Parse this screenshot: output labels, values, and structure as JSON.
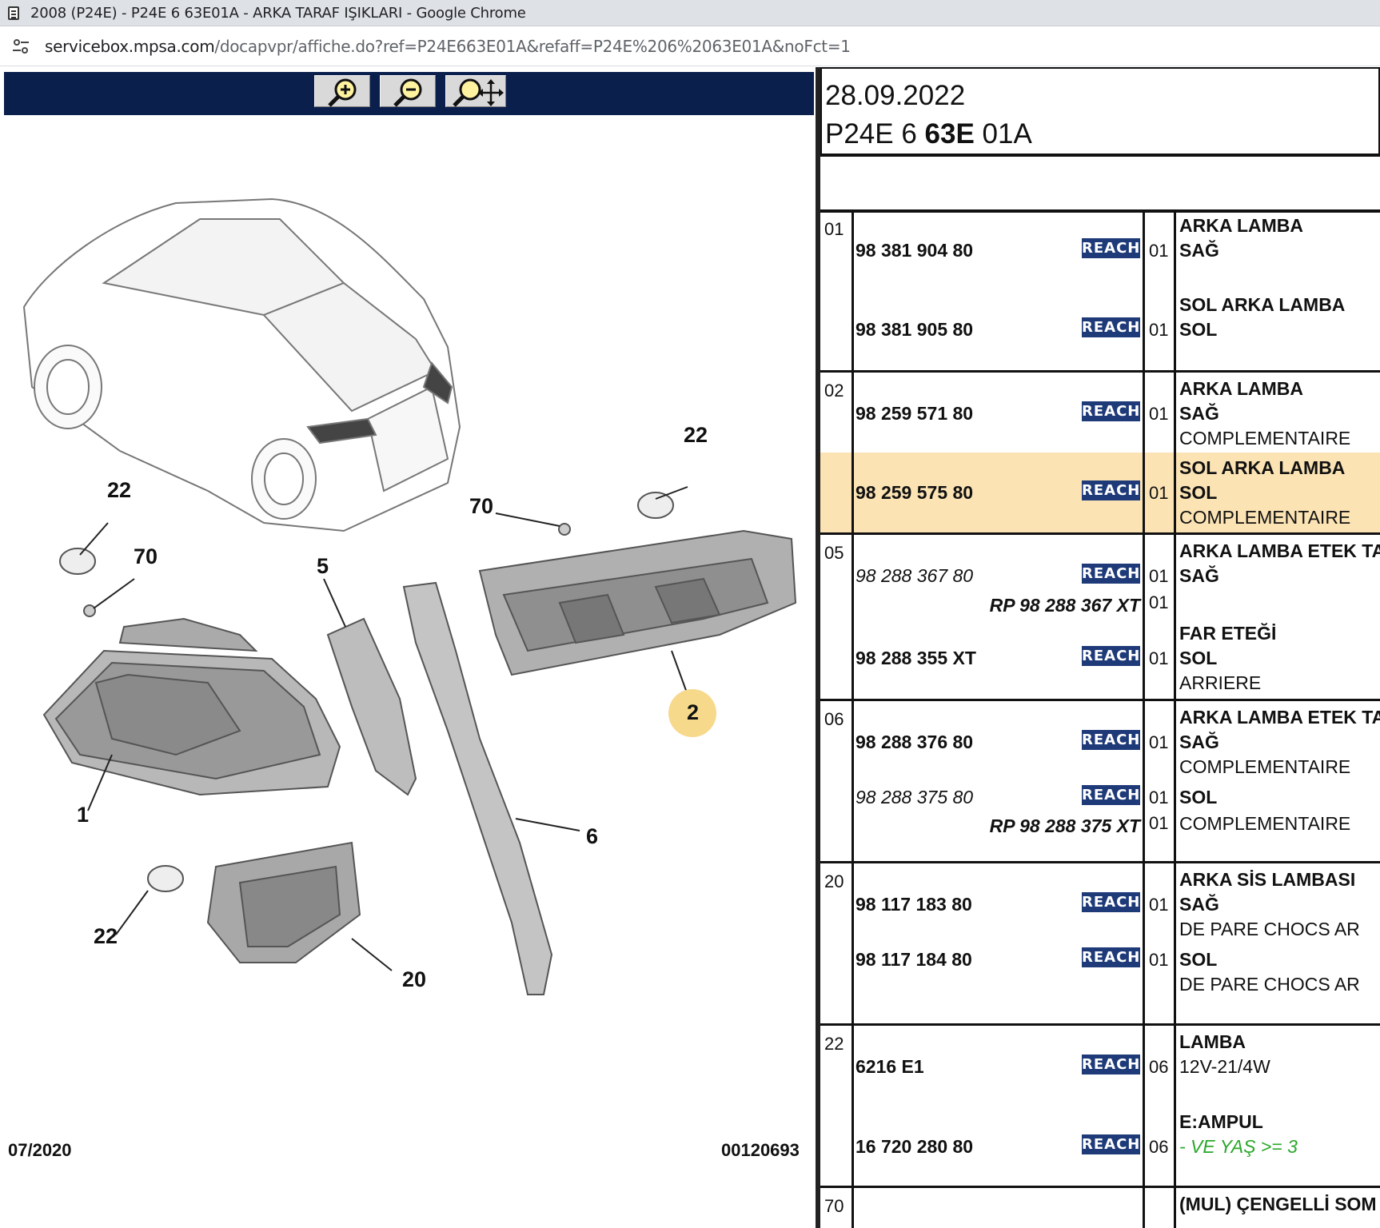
{
  "browser": {
    "title": "2008 (P24E) - P24E 6 63E01A - ARKA TARAF IŞIKLARI - Google Chrome",
    "url_host": "servicebox.mpsa.com",
    "url_path": "/docapvpr/affiche.do?ref=P24E663E01A&refaff=P24E%206%2063E01A&noFct=1"
  },
  "toolbar": {
    "zoom_in": "zoom-in-icon",
    "zoom_out": "zoom-out-icon",
    "pan": "zoom-pan-icon"
  },
  "diagram": {
    "date_code": "07/2020",
    "image_code": "00120693",
    "callouts": [
      "22",
      "22",
      "70",
      "70",
      "5",
      "1",
      "6",
      "2",
      "22",
      "20"
    ],
    "highlight_color": "#f7d98c"
  },
  "header": {
    "date": "28.09.2022",
    "ref_pre": "P24E 6 ",
    "ref_bold": "63E",
    "ref_post": " 01A"
  },
  "colors": {
    "toolbar": "#0b1f4d",
    "reach_badge": "#1e3a78",
    "highlight_row": "#fbe3b4",
    "green_note": "#2aa82a"
  },
  "reach_label": "REACH",
  "groups": [
    {
      "ref": "01",
      "lines": [
        {
          "pn": "98 381 904 80",
          "qty": "01",
          "desc1": "ARKA LAMBA",
          "desc2": "SAĞ"
        },
        {
          "pn": "98 381 905 80",
          "qty": "01",
          "desc1": "SOL ARKA LAMBA",
          "desc2": "SOL"
        }
      ]
    },
    {
      "ref": "02",
      "lines": [
        {
          "pn": "98 259 571 80",
          "qty": "01",
          "desc1": "ARKA LAMBA",
          "desc2": "SAĞ",
          "desc3": "COMPLEMENTAIRE"
        },
        {
          "pn": "98 259 575 80",
          "qty": "01",
          "desc1": "SOL ARKA LAMBA",
          "desc2": "SOL",
          "desc3": "COMPLEMENTAIRE"
        }
      ]
    },
    {
      "ref": "05",
      "lines": [
        {
          "pn": "98 288 367 80",
          "rp": "RP 98 288 367 XT",
          "qty": "01",
          "qty_rp": "01",
          "desc1": "ARKA LAMBA ETEK TA",
          "desc2": "SAĞ"
        },
        {
          "pn": "98 288 355 XT",
          "qty": "01",
          "desc1": "FAR ETEĞİ",
          "desc2": "SOL",
          "desc3": "ARRIERE"
        }
      ]
    },
    {
      "ref": "06",
      "lines": [
        {
          "pn": "98 288 376 80",
          "qty": "01",
          "desc1": "ARKA LAMBA ETEK TA",
          "desc2": "SAĞ",
          "desc3": "COMPLEMENTAIRE"
        },
        {
          "pn": "98 288 375 80",
          "rp": "RP 98 288 375 XT",
          "qty": "01",
          "qty_rp": "01",
          "desc2": "SOL",
          "desc3": "COMPLEMENTAIRE"
        }
      ]
    },
    {
      "ref": "20",
      "lines": [
        {
          "pn": "98 117 183 80",
          "qty": "01",
          "desc1": "ARKA SİS LAMBASI",
          "desc2": "SAĞ",
          "desc3": "DE PARE CHOCS AR"
        },
        {
          "pn": "98 117 184 80",
          "qty": "01",
          "desc2": "SOL",
          "desc3": "DE PARE CHOCS AR"
        }
      ]
    },
    {
      "ref": "22",
      "lines": [
        {
          "pn": "6216 E1",
          "qty": "06",
          "desc1": "LAMBA",
          "desc2": "12V-21/4W"
        },
        {
          "pn": "16 720 280 80",
          "qty": "06",
          "desc1": "E:AMPUL",
          "desc2": "- VE YAŞ >= 3"
        }
      ]
    },
    {
      "ref": "70",
      "lines": [
        {
          "desc1": "(MUL) ÇENGELLİ SOM"
        }
      ]
    }
  ]
}
